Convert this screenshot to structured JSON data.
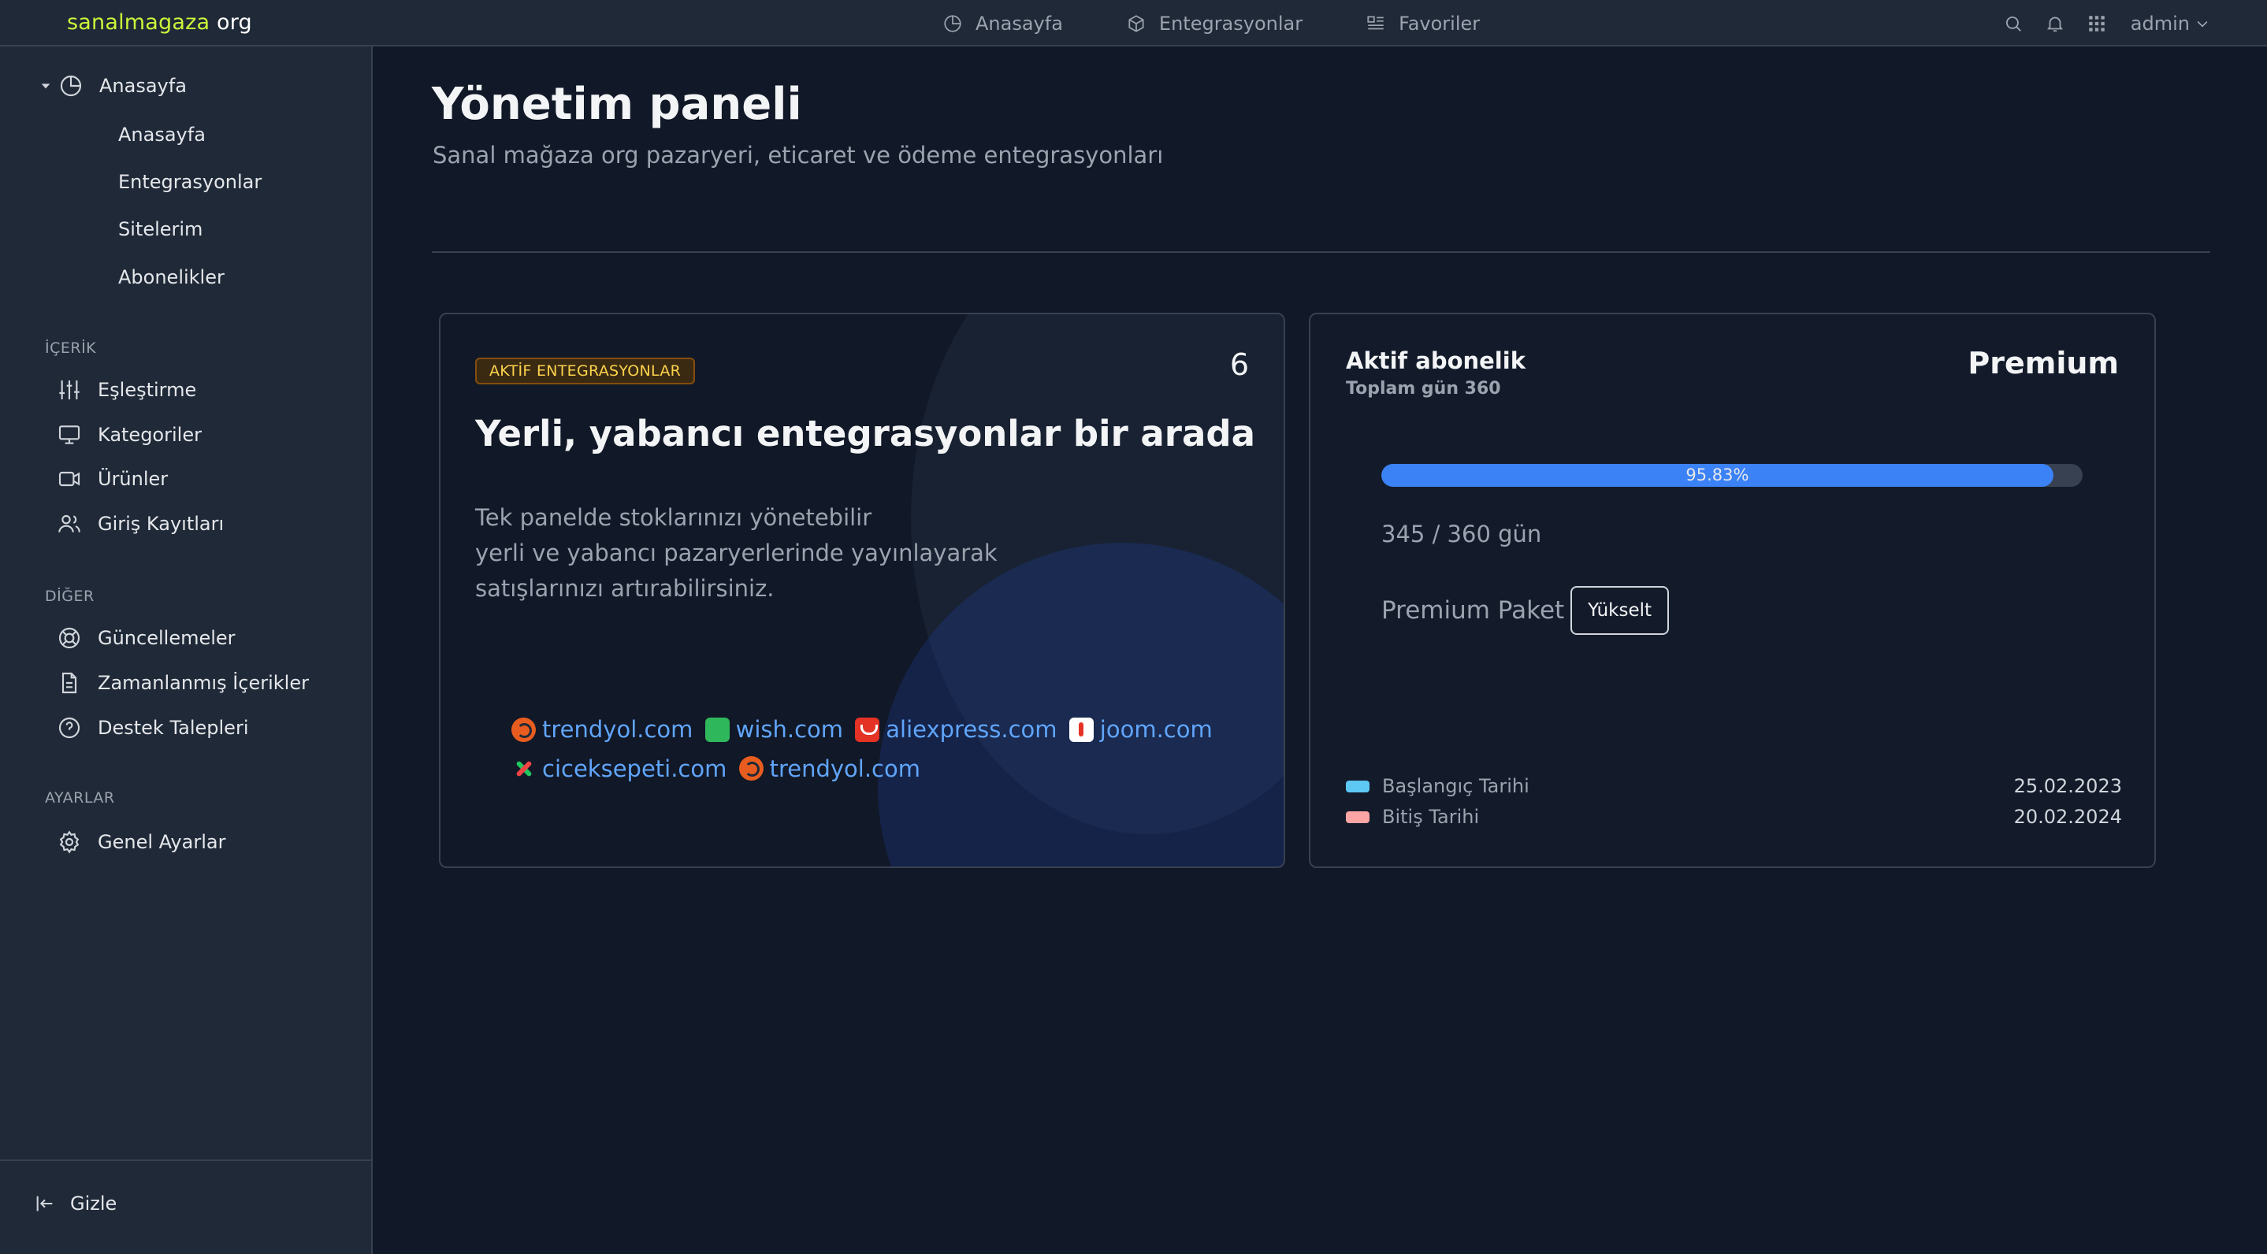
{
  "brand": {
    "accent": "sanalmagaza",
    "rest": " org"
  },
  "topnav": [
    {
      "label": "Anasayfa",
      "icon": "pie-chart-icon"
    },
    {
      "label": "Entegrasyonlar",
      "icon": "cube-icon"
    },
    {
      "label": "Favoriler",
      "icon": "list-icon"
    }
  ],
  "user": {
    "name": "admin"
  },
  "sidebar": {
    "group": {
      "label": "Anasayfa",
      "icon": "pie-chart-icon"
    },
    "sub_items": [
      "Anasayfa",
      "Entegrasyonlar",
      "Sitelerim",
      "Abonelikler"
    ],
    "sections": [
      {
        "title": "İÇERİK",
        "items": [
          {
            "label": "Eşleştirme",
            "icon": "sliders-icon"
          },
          {
            "label": "Kategoriler",
            "icon": "monitor-icon"
          },
          {
            "label": "Ürünler",
            "icon": "video-icon"
          },
          {
            "label": "Giriş Kayıtları",
            "icon": "users-icon"
          }
        ]
      },
      {
        "title": "DİĞER",
        "items": [
          {
            "label": "Güncellemeler",
            "icon": "lifebuoy-icon"
          },
          {
            "label": "Zamanlanmış İçerikler",
            "icon": "document-icon"
          },
          {
            "label": "Destek Talepleri",
            "icon": "help-circle-icon"
          }
        ]
      },
      {
        "title": "AYARLAR",
        "items": [
          {
            "label": "Genel Ayarlar",
            "icon": "gear-icon"
          }
        ]
      }
    ],
    "footer": {
      "label": "Gizle",
      "icon": "collapse-left-icon"
    }
  },
  "page": {
    "title": "Yönetim paneli",
    "subtitle": "Sanal mağaza org pazaryeri, eticaret ve ödeme entegrasyonları"
  },
  "integrations_card": {
    "badge": "AKTİF ENTEGRASYONLAR",
    "count": "6",
    "heading": "Yerli, yabancı entegrasyonlar bir arada",
    "text_lines": [
      "Tek panelde stoklarınızı yönetebilir",
      "yerli ve yabancı pazaryerlerinde yayınlayarak",
      "satışlarınızı artırabilirsiniz."
    ],
    "marketplaces": [
      {
        "name": "trendyol.com",
        "logo": "trendyol"
      },
      {
        "name": "wish.com",
        "logo": "wish"
      },
      {
        "name": "aliexpress.com",
        "logo": "ali"
      },
      {
        "name": "joom.com",
        "logo": "joom"
      },
      {
        "name": "ciceksepeti.com",
        "logo": "cicek"
      },
      {
        "name": "trendyol.com",
        "logo": "trendyol"
      }
    ]
  },
  "subscription_card": {
    "title": "Aktif abonelik",
    "total_days": "Toplam gün 360",
    "plan": "Premium",
    "progress_percent": 95.83,
    "progress_label": "95.83%",
    "used_label": "345 / 360 gün",
    "package_label": "Premium Paket",
    "upgrade_label": "Yükselt",
    "dates": [
      {
        "label": "Başlangıç Tarihi",
        "value": "25.02.2023",
        "color": "#5ec8f5"
      },
      {
        "label": "Bitiş Tarihi",
        "value": "20.02.2024",
        "color": "#fca5a5"
      }
    ]
  },
  "colors": {
    "accent": "#c9f53a",
    "progress": "#3b82f6",
    "badge": "#fcd34d"
  }
}
